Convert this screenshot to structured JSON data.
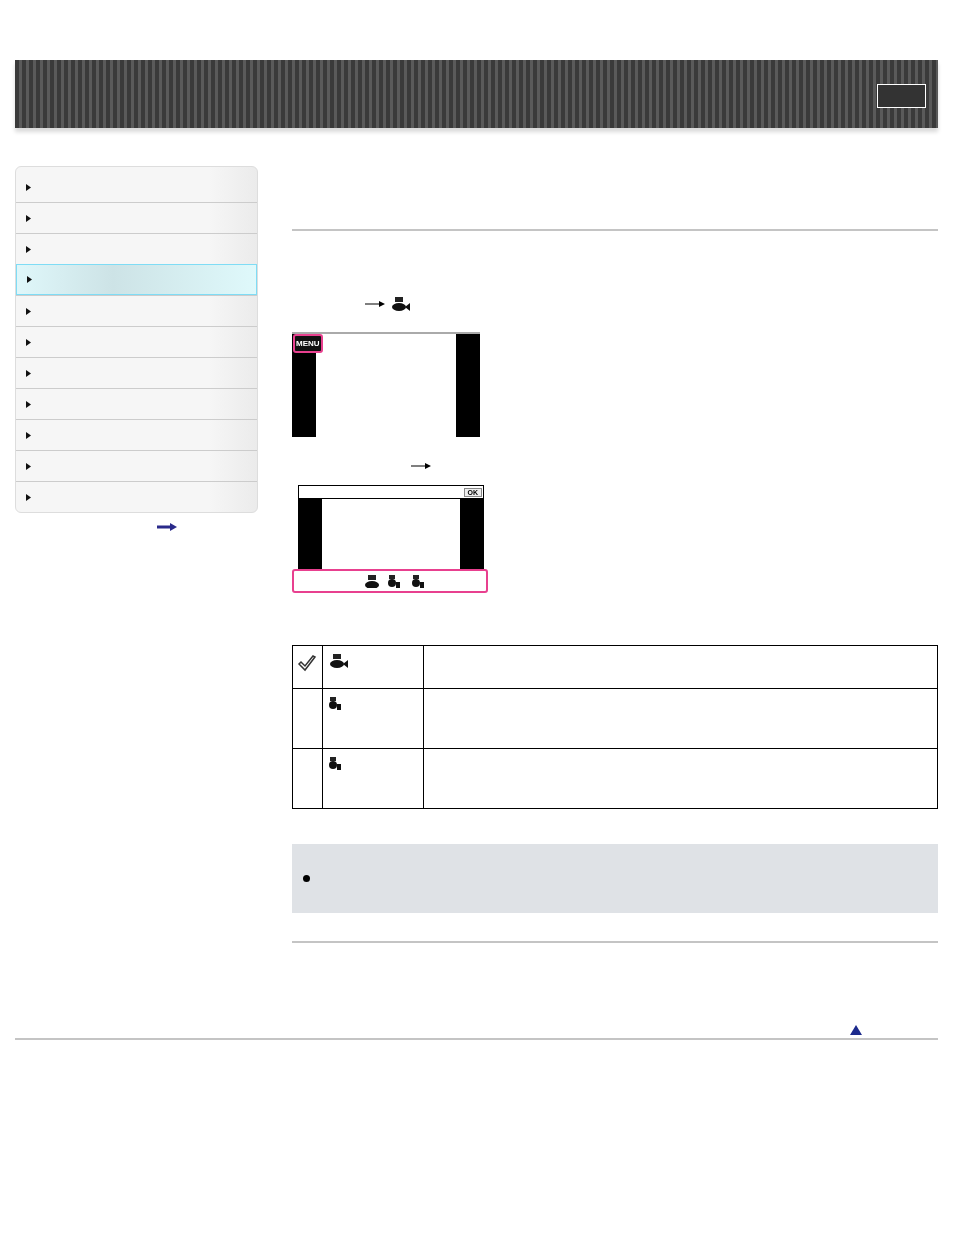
{
  "sidebar": {
    "items": [
      {
        "selected": false
      },
      {
        "selected": false
      },
      {
        "selected": false
      },
      {
        "selected": true
      },
      {
        "selected": false
      },
      {
        "selected": false
      },
      {
        "selected": false
      },
      {
        "selected": false
      },
      {
        "selected": false
      },
      {
        "selected": false
      },
      {
        "selected": false
      }
    ]
  },
  "screens": [
    {
      "menu_label": "MENU"
    },
    {
      "ok_label": "OK"
    }
  ],
  "table": {
    "rows": [
      {
        "checked": true,
        "kind": "large"
      },
      {
        "checked": false,
        "kind": "small"
      },
      {
        "checked": false,
        "kind": "small"
      }
    ]
  }
}
